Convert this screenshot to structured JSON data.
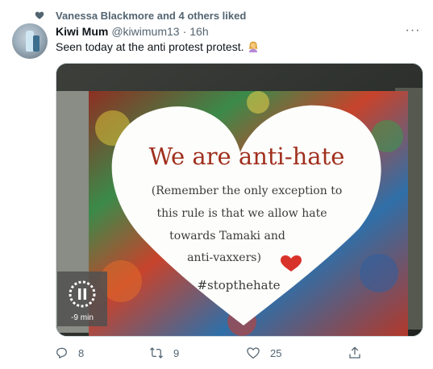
{
  "social_context": {
    "text": "Vanessa Blackmore and 4 others liked"
  },
  "author": {
    "display_name": "Kiwi Mum",
    "handle": "@kiwimum13",
    "separator": "·",
    "timestamp": "16h"
  },
  "more_label": "···",
  "tweet_text": "Seen today at the anti protest protest.",
  "media": {
    "sign": {
      "line1": "We are anti-hate",
      "line2": "(Remember the only exception to",
      "line3": "this rule is that we allow hate",
      "line4": "towards Tamaki and",
      "line5": "anti-vaxxers)",
      "hashtag": "#stopthehate"
    },
    "video_time": "-9 min"
  },
  "actions": {
    "reply_count": "8",
    "retweet_count": "9",
    "like_count": "25"
  },
  "colors": {
    "text": "#0f1419",
    "secondary": "#536471",
    "border": "#cfd9de",
    "sign_ink": "#a0301e"
  },
  "icons": [
    "heart-icon",
    "more-icon",
    "facepalm-emoji-icon",
    "pause-icon",
    "reply-icon",
    "retweet-icon",
    "like-icon",
    "share-icon"
  ]
}
